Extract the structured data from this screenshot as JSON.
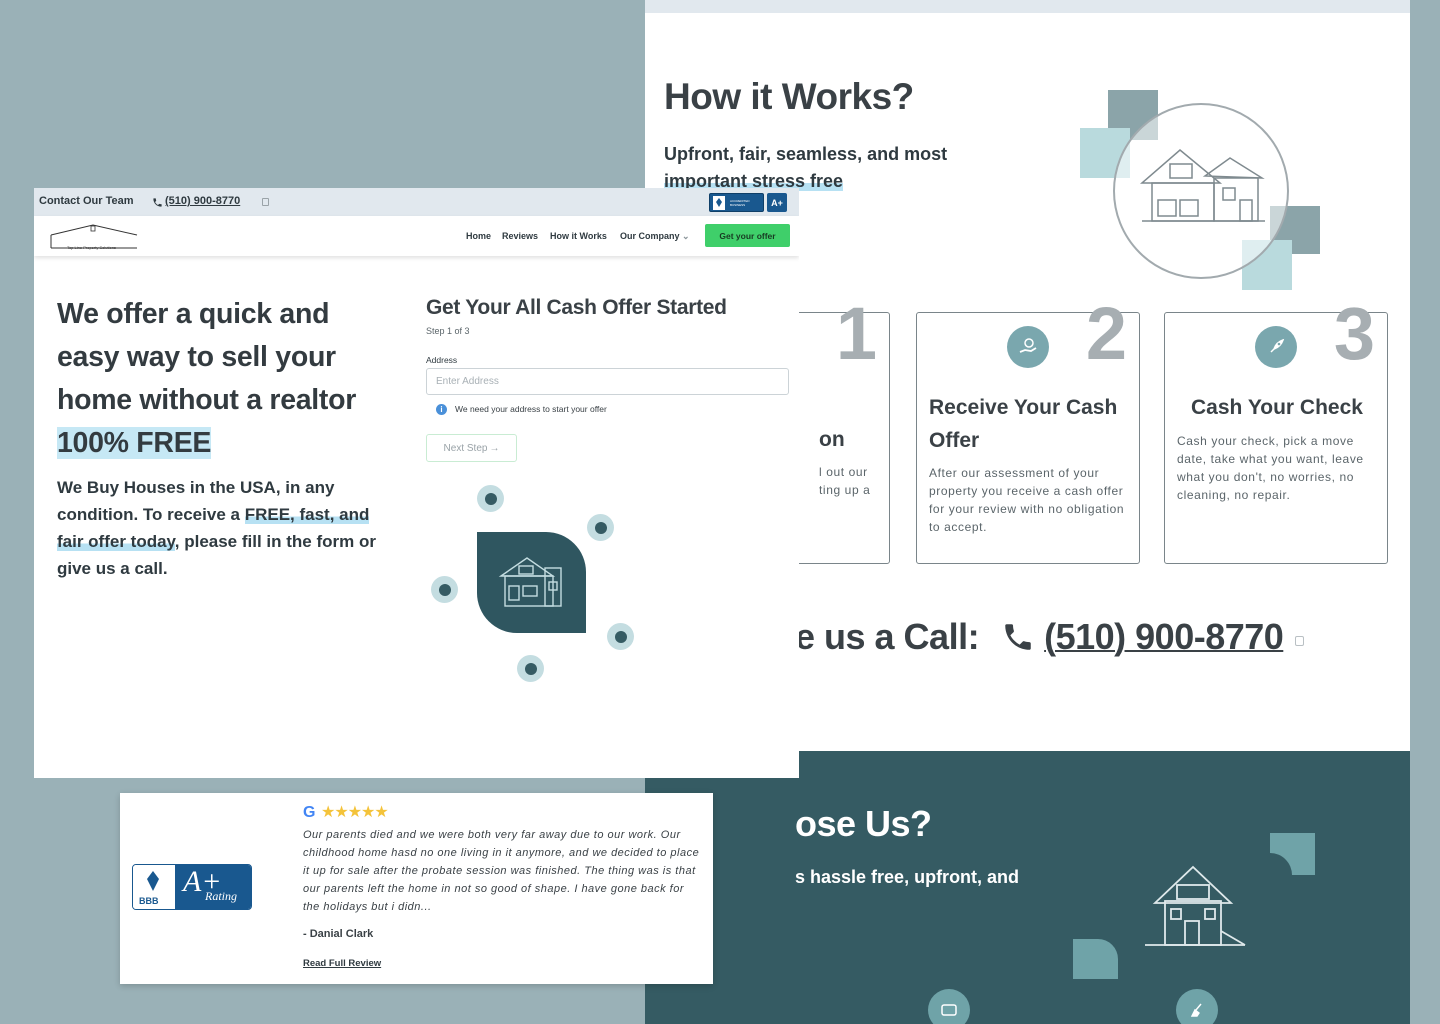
{
  "topbar": {
    "contact_label": "Contact Our Team",
    "phone": "(510) 900-8770",
    "bbb_small_text": "ACCREDITED BUSINESS",
    "bbb_small_rating": "A+"
  },
  "logo": {
    "text": "Top Line Property Solutions"
  },
  "nav": {
    "items": [
      {
        "label": "Home"
      },
      {
        "label": "Reviews"
      },
      {
        "label": "How it Works"
      },
      {
        "label": "Our Company"
      }
    ],
    "cta": "Get your offer"
  },
  "hero": {
    "title": "We offer a quick and easy way to sell your home without a realtor",
    "free": "100% FREE",
    "sub_pre": "We Buy Houses in the USA, in any condition. To receive a ",
    "sub_highlight": "FREE, fast, and fair offer today",
    "sub_post": ", please fill in the form or give us a call."
  },
  "form": {
    "title": "Get Your All Cash Offer Started",
    "step": "Step 1 of 3",
    "address_label": "Address",
    "address_placeholder": "Enter Address",
    "address_value": "",
    "hint": "We need your address to start your offer",
    "next_button": "Next Step"
  },
  "how_it_works": {
    "title": "How it Works?",
    "sub_pre": "Upfront, fair, seamless, and most ",
    "sub_highlight": "important stress free",
    "steps": [
      {
        "number": "1",
        "title": "on",
        "description": "l out our\nting up a"
      },
      {
        "number": "2",
        "title": "Receive Your Cash Offer",
        "description": "After our assessment of your property you receive a cash offer for your review with no obligation to accept."
      },
      {
        "number": "3",
        "title": "Cash Your Check",
        "description": "Cash your check, pick a move date, take what you want, leave what you don't, no worries, no cleaning, no repair."
      }
    ]
  },
  "call": {
    "label": "e us a Call:",
    "phone": "(510) 900-8770"
  },
  "why": {
    "title": "ose Us?",
    "sub": "s hassle free, upfront, and"
  },
  "review": {
    "bbb_letters": "BBB",
    "bbb_grade": "A+",
    "bbb_word": "Rating",
    "google_letter": "G",
    "stars": "★★★★★",
    "text": "Our parents died and we were both very far away due to our work. Our childhood home hasd no one living in it anymore, and we decided to place it up for sale after the probate session was finished. The thing was is that our parents left the home in not so good of shape. I have gone back for the holidays but i didn...",
    "author": "- Danial Clark",
    "link": "Read Full Review"
  },
  "colors": {
    "background": "#9ab1b7",
    "teal_dark": "#355b63",
    "cta_green": "#3fcf6a",
    "highlight": "#c6e8f5",
    "bbb_blue": "#19588f",
    "star_yellow": "#f4c33a"
  }
}
